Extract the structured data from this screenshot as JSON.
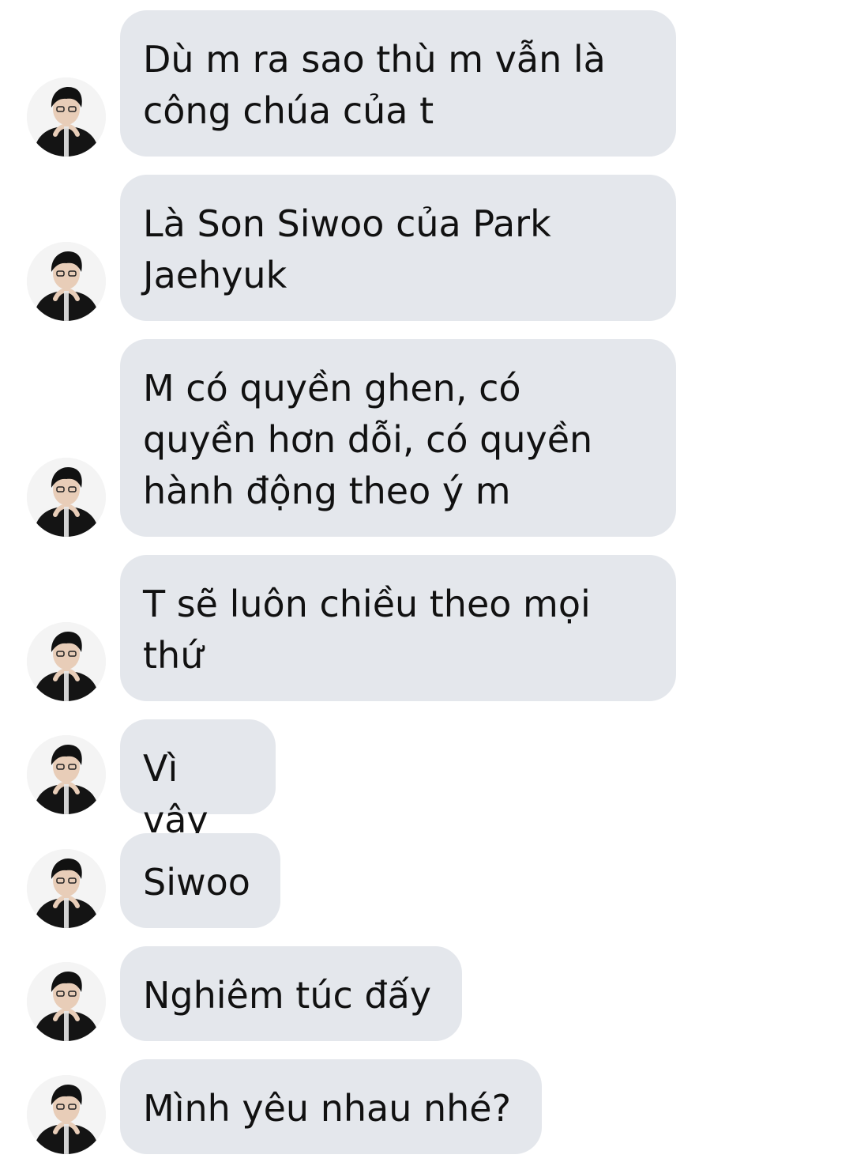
{
  "conversation": {
    "messages": [
      {
        "text": "Dù m ra sao thù m vẫn là\ncông chúa của t"
      },
      {
        "text": "Là Son Siwoo của Park\nJaehyuk"
      },
      {
        "text": "M có quyền ghen, có\nquyền hơn dỗi, có quyền\nhành động theo ý m"
      },
      {
        "text": "T sẽ luôn chiều theo mọi\nthứ"
      },
      {
        "text": "Vì vậy"
      },
      {
        "text": "Siwoo"
      },
      {
        "text": "Nghiêm túc đấy"
      },
      {
        "text": "Mình yêu nhau nhé?"
      }
    ]
  },
  "colors": {
    "bubble": "#e4e7ec",
    "text": "#111111",
    "background": "#ffffff"
  },
  "icons": {
    "avatar": "contact-avatar-icon"
  }
}
